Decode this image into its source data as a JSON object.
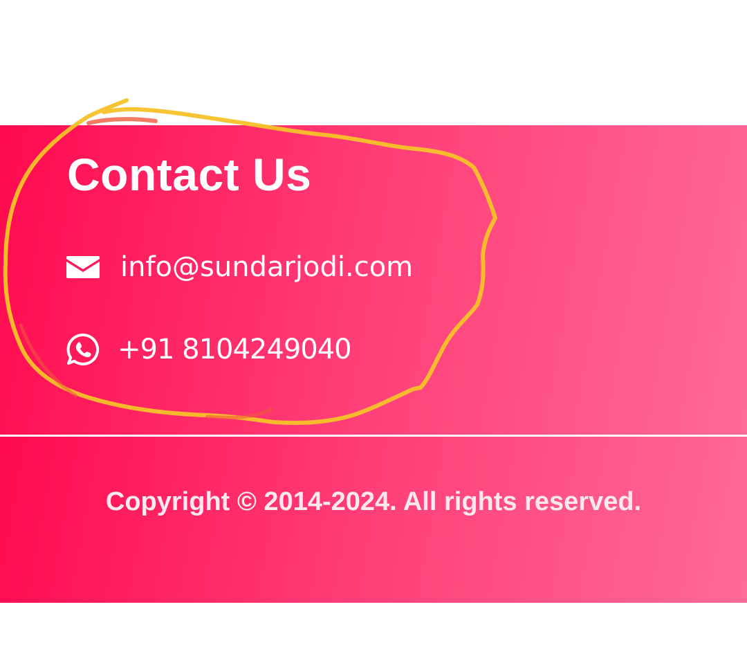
{
  "contact": {
    "title": "Contact Us",
    "email": {
      "icon": "envelope-icon",
      "text": "info@sundarjodi.com"
    },
    "phone": {
      "icon": "whatsapp-icon",
      "text": "+91 8104249040"
    }
  },
  "footer": {
    "copyright": "Copyright © 2014-2024. All rights reserved."
  },
  "colors": {
    "gradient_start": "#ff0a4f",
    "gradient_end": "#ff6a98",
    "text": "#ffffff",
    "annotation_stroke": "#f7c229"
  },
  "annotation": {
    "type": "freehand-circle",
    "color": "#f7c229"
  }
}
